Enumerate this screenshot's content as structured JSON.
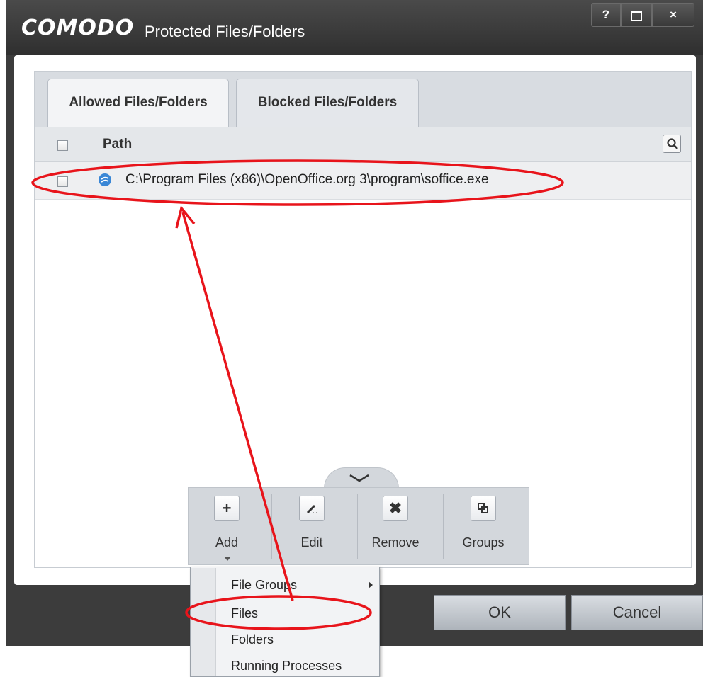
{
  "window": {
    "logo": "COMODO",
    "title": "Protected Files/Folders",
    "help_label": "?",
    "close_label": "×"
  },
  "tabs": [
    {
      "label": "Allowed Files/Folders",
      "active": true
    },
    {
      "label": "Blocked Files/Folders",
      "active": false
    }
  ],
  "table": {
    "column_header": "Path",
    "rows": [
      {
        "path": "C:\\Program Files (x86)\\OpenOffice.org 3\\program\\soffice.exe",
        "icon": "openoffice-icon"
      }
    ]
  },
  "toolbar": {
    "add_label": "Add",
    "add_icon": "+",
    "edit_label": "Edit",
    "remove_label": "Remove",
    "remove_icon": "✖",
    "groups_label": "Groups"
  },
  "context_menu": {
    "items": [
      "File Groups",
      "Files",
      "Folders",
      "Running Processes"
    ]
  },
  "dialog_buttons": {
    "ok_label": "OK",
    "cancel_label": "Cancel"
  },
  "colors": {
    "annotation": "#e8141b",
    "frame": "#3c3c3c"
  }
}
